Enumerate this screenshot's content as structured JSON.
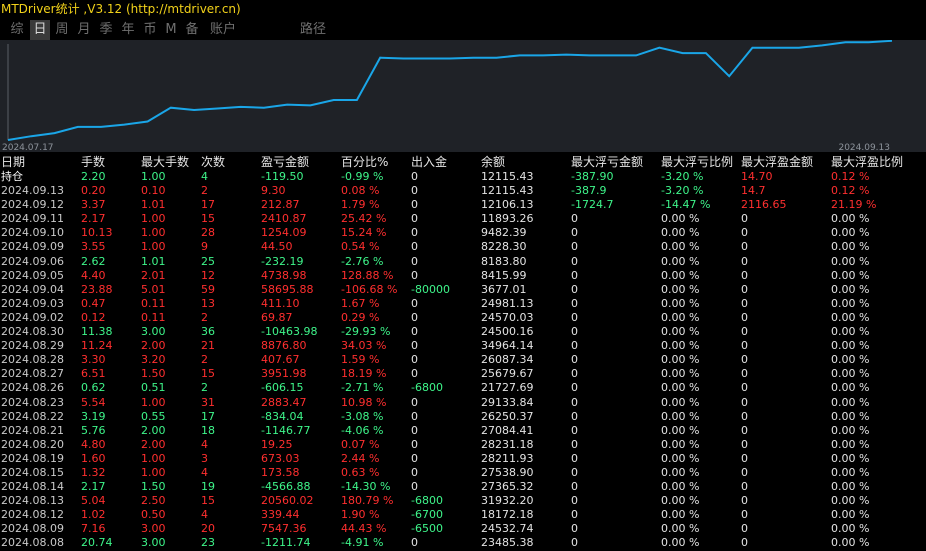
{
  "title": "MTDriver统计 ,V3.12 (http://mtdriver.cn)",
  "tabs": [
    "综",
    "日",
    "周",
    "月",
    "季",
    "年",
    "币",
    "M",
    "备",
    "账户",
    "路径"
  ],
  "active_tab": "日",
  "colors": {
    "positive": "#3ef58a",
    "negative": "#ff2f2f",
    "line": "#1aa6e8",
    "panel": "#1f2227"
  },
  "chart_data": {
    "type": "line",
    "x_start_label": "2024.07.17",
    "x_end_label": "2024.09.13",
    "values": [
      0.0,
      0.05,
      0.09,
      0.17,
      0.17,
      0.2,
      0.24,
      0.42,
      0.39,
      0.41,
      0.43,
      0.42,
      0.46,
      0.45,
      0.52,
      0.52,
      1.07,
      1.06,
      1.06,
      1.06,
      1.07,
      1.07,
      1.1,
      1.1,
      1.11,
      1.1,
      1.1,
      1.1,
      1.2,
      1.13,
      1.13,
      0.83,
      1.2,
      1.2,
      1.2,
      1.23,
      1.27,
      1.27,
      1.29
    ]
  },
  "table": {
    "headers": [
      "日期",
      "手数",
      "最大手数",
      "次数",
      "盈亏金额",
      "百分比%",
      "出入金",
      "余额",
      "最大浮亏金额",
      "最大浮亏比例",
      "最大浮盈金额",
      "最大浮盈比例"
    ],
    "rows": [
      {
        "c": [
          "持仓",
          "2.20",
          "1.00",
          "4",
          "-119.50",
          "-0.99 %",
          "0",
          "12115.43",
          "-387.90",
          "-3.20 %",
          "14.70",
          "0.12 %"
        ],
        "s": "g",
        "first": "w",
        "ex": {
          "8": "g",
          "9": "g",
          "10": "r",
          "11": "r"
        }
      },
      {
        "c": [
          "2024.09.13",
          "0.20",
          "0.10",
          "2",
          "9.30",
          "0.08 %",
          "0",
          "12115.43",
          "-387.9",
          "-3.20 %",
          "14.7",
          "0.12 %"
        ],
        "s": "r",
        "first": "wd",
        "ex": {
          "8": "g",
          "9": "g",
          "10": "r",
          "11": "r"
        }
      },
      {
        "c": [
          "2024.09.12",
          "3.37",
          "1.01",
          "17",
          "212.87",
          "1.79 %",
          "0",
          "12106.13",
          "-1724.7",
          "-14.47 %",
          "2116.65",
          "21.19 %"
        ],
        "s": "r",
        "first": "wd",
        "ex": {
          "8": "g",
          "9": "g",
          "10": "r",
          "11": "r"
        }
      },
      {
        "c": [
          "2024.09.11",
          "2.17",
          "1.00",
          "15",
          "2410.87",
          "25.42 %",
          "0",
          "11893.26",
          "0",
          "0.00 %",
          "0",
          "0.00 %"
        ],
        "s": "r",
        "first": "wd"
      },
      {
        "c": [
          "2024.09.10",
          "10.13",
          "1.00",
          "28",
          "1254.09",
          "15.24 %",
          "0",
          "9482.39",
          "0",
          "0.00 %",
          "0",
          "0.00 %"
        ],
        "s": "r",
        "first": "wd"
      },
      {
        "c": [
          "2024.09.09",
          "3.55",
          "1.00",
          "9",
          "44.50",
          "0.54 %",
          "0",
          "8228.30",
          "0",
          "0.00 %",
          "0",
          "0.00 %"
        ],
        "s": "r",
        "first": "wd"
      },
      {
        "c": [
          "2024.09.06",
          "2.62",
          "1.01",
          "25",
          "-232.19",
          "-2.76 %",
          "0",
          "8183.80",
          "0",
          "0.00 %",
          "0",
          "0.00 %"
        ],
        "s": "g",
        "first": "wd"
      },
      {
        "c": [
          "2024.09.05",
          "4.40",
          "2.01",
          "12",
          "4738.98",
          "128.88 %",
          "0",
          "8415.99",
          "0",
          "0.00 %",
          "0",
          "0.00 %"
        ],
        "s": "r",
        "first": "wd"
      },
      {
        "c": [
          "2024.09.04",
          "23.88",
          "5.01",
          "59",
          "58695.88",
          "-106.68 %",
          "-80000",
          "3677.01",
          "0",
          "0.00 %",
          "0",
          "0.00 %"
        ],
        "s": "r",
        "first": "wd",
        "ex": {
          "6": "g"
        }
      },
      {
        "c": [
          "2024.09.03",
          "0.47",
          "0.11",
          "13",
          "411.10",
          "1.67 %",
          "0",
          "24981.13",
          "0",
          "0.00 %",
          "0",
          "0.00 %"
        ],
        "s": "r",
        "first": "wd"
      },
      {
        "c": [
          "2024.09.02",
          "0.12",
          "0.11",
          "2",
          "69.87",
          "0.29 %",
          "0",
          "24570.03",
          "0",
          "0.00 %",
          "0",
          "0.00 %"
        ],
        "s": "r",
        "first": "wd"
      },
      {
        "c": [
          "2024.08.30",
          "11.38",
          "3.00",
          "36",
          "-10463.98",
          "-29.93 %",
          "0",
          "24500.16",
          "0",
          "0.00 %",
          "0",
          "0.00 %"
        ],
        "s": "g",
        "first": "wd"
      },
      {
        "c": [
          "2024.08.29",
          "11.24",
          "2.00",
          "21",
          "8876.80",
          "34.03 %",
          "0",
          "34964.14",
          "0",
          "0.00 %",
          "0",
          "0.00 %"
        ],
        "s": "r",
        "first": "wd"
      },
      {
        "c": [
          "2024.08.28",
          "3.30",
          "3.20",
          "2",
          "407.67",
          "1.59 %",
          "0",
          "26087.34",
          "0",
          "0.00 %",
          "0",
          "0.00 %"
        ],
        "s": "r",
        "first": "wd"
      },
      {
        "c": [
          "2024.08.27",
          "6.51",
          "1.50",
          "15",
          "3951.98",
          "18.19 %",
          "0",
          "25679.67",
          "0",
          "0.00 %",
          "0",
          "0.00 %"
        ],
        "s": "r",
        "first": "wd"
      },
      {
        "c": [
          "2024.08.26",
          "0.62",
          "0.51",
          "2",
          "-606.15",
          "-2.71 %",
          "-6800",
          "21727.69",
          "0",
          "0.00 %",
          "0",
          "0.00 %"
        ],
        "s": "g",
        "first": "wd",
        "ex": {
          "6": "g"
        }
      },
      {
        "c": [
          "2024.08.23",
          "5.54",
          "1.00",
          "31",
          "2883.47",
          "10.98 %",
          "0",
          "29133.84",
          "0",
          "0.00 %",
          "0",
          "0.00 %"
        ],
        "s": "r",
        "first": "wd"
      },
      {
        "c": [
          "2024.08.22",
          "3.19",
          "0.55",
          "17",
          "-834.04",
          "-3.08 %",
          "0",
          "26250.37",
          "0",
          "0.00 %",
          "0",
          "0.00 %"
        ],
        "s": "g",
        "first": "wd"
      },
      {
        "c": [
          "2024.08.21",
          "5.76",
          "2.00",
          "18",
          "-1146.77",
          "-4.06 %",
          "0",
          "27084.41",
          "0",
          "0.00 %",
          "0",
          "0.00 %"
        ],
        "s": "g",
        "first": "wd"
      },
      {
        "c": [
          "2024.08.20",
          "4.80",
          "2.00",
          "4",
          "19.25",
          "0.07 %",
          "0",
          "28231.18",
          "0",
          "0.00 %",
          "0",
          "0.00 %"
        ],
        "s": "r",
        "first": "wd"
      },
      {
        "c": [
          "2024.08.19",
          "1.60",
          "1.00",
          "3",
          "673.03",
          "2.44 %",
          "0",
          "28211.93",
          "0",
          "0.00 %",
          "0",
          "0.00 %"
        ],
        "s": "r",
        "first": "wd"
      },
      {
        "c": [
          "2024.08.15",
          "1.32",
          "1.00",
          "4",
          "173.58",
          "0.63 %",
          "0",
          "27538.90",
          "0",
          "0.00 %",
          "0",
          "0.00 %"
        ],
        "s": "r",
        "first": "wd"
      },
      {
        "c": [
          "2024.08.14",
          "2.17",
          "1.50",
          "19",
          "-4566.88",
          "-14.30 %",
          "0",
          "27365.32",
          "0",
          "0.00 %",
          "0",
          "0.00 %"
        ],
        "s": "g",
        "first": "wd"
      },
      {
        "c": [
          "2024.08.13",
          "5.04",
          "2.50",
          "15",
          "20560.02",
          "180.79 %",
          "-6800",
          "31932.20",
          "0",
          "0.00 %",
          "0",
          "0.00 %"
        ],
        "s": "r",
        "first": "wd",
        "ex": {
          "6": "g"
        }
      },
      {
        "c": [
          "2024.08.12",
          "1.02",
          "0.50",
          "4",
          "339.44",
          "1.90 %",
          "-6700",
          "18172.18",
          "0",
          "0.00 %",
          "0",
          "0.00 %"
        ],
        "s": "r",
        "first": "wd",
        "ex": {
          "6": "g"
        }
      },
      {
        "c": [
          "2024.08.09",
          "7.16",
          "3.00",
          "20",
          "7547.36",
          "44.43 %",
          "-6500",
          "24532.74",
          "0",
          "0.00 %",
          "0",
          "0.00 %"
        ],
        "s": "r",
        "first": "wd",
        "ex": {
          "6": "g"
        }
      },
      {
        "c": [
          "2024.08.08",
          "20.74",
          "3.00",
          "23",
          "-1211.74",
          "-4.91 %",
          "0",
          "23485.38",
          "0",
          "0.00 %",
          "0",
          "0.00 %"
        ],
        "s": "g",
        "first": "wd"
      }
    ]
  }
}
